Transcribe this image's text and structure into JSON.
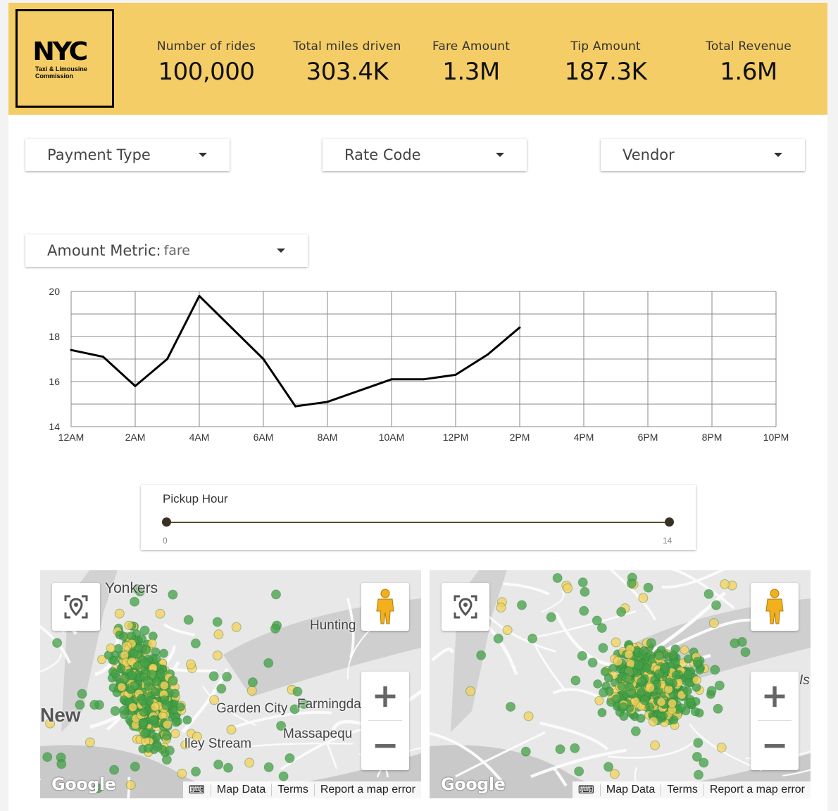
{
  "logo": {
    "big": "NYC",
    "line1": "Taxi & Limousine",
    "line2": "Commission"
  },
  "kpis": [
    {
      "label": "Number of rides",
      "value": "100,000"
    },
    {
      "label": "Total miles driven",
      "value": "303.4K"
    },
    {
      "label": "Fare Amount",
      "value": "1.3M"
    },
    {
      "label": "Tip Amount",
      "value": "187.3K"
    },
    {
      "label": "Total Revenue",
      "value": "1.6M"
    }
  ],
  "filters": {
    "payment_type": "Payment Type",
    "rate_code": "Rate Code",
    "vendor": "Vendor",
    "amount_metric_label": "Amount Metric:",
    "amount_metric_value": "fare"
  },
  "chart_data": {
    "type": "line",
    "x_ticks": [
      "12AM",
      "2AM",
      "4AM",
      "6AM",
      "8AM",
      "10AM",
      "12PM",
      "2PM",
      "4PM",
      "6PM",
      "8PM",
      "10PM"
    ],
    "y_ticks": [
      "14",
      "16",
      "18",
      "20"
    ],
    "ylim": [
      14,
      20
    ],
    "xlim": [
      0,
      22
    ],
    "grid": true,
    "series": [
      {
        "x": [
          0,
          1,
          2,
          3,
          4,
          5,
          6,
          7,
          8,
          9,
          10,
          11,
          12,
          13,
          14
        ],
        "values": [
          17.4,
          17.1,
          15.8,
          17.0,
          19.8,
          18.4,
          17.0,
          14.9,
          15.1,
          15.6,
          16.1,
          16.1,
          16.3,
          17.2,
          18.4
        ]
      }
    ]
  },
  "slider": {
    "title": "Pickup Hour",
    "min": "0",
    "max": "14",
    "low": 0,
    "high": 14
  },
  "map1": {
    "places": [
      "Yonkers",
      "Hunting",
      "New",
      "Garden City",
      "Farmingda",
      "Massapequ",
      "lley Stream"
    ],
    "footer": [
      "Map Data",
      "Terms",
      "Report a map error"
    ],
    "google": "Google"
  },
  "map2": {
    "places": [
      "Is"
    ],
    "footer": [
      "Map Data",
      "Terms",
      "Report a map error"
    ],
    "google": "Google"
  },
  "colors": {
    "header": "#f4cd66",
    "green": "#43a047",
    "yellow": "#f6d25c"
  }
}
